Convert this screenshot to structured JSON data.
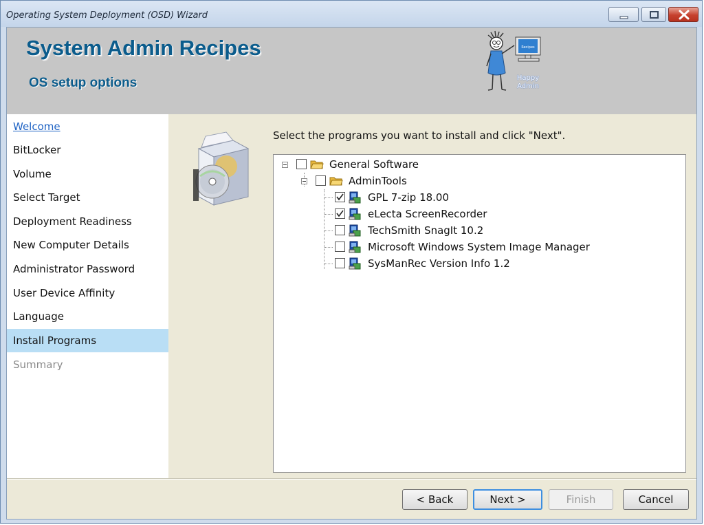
{
  "window": {
    "title": "Operating System Deployment (OSD) Wizard",
    "controls": [
      "minimize-icon",
      "maximize-icon",
      "close-icon"
    ]
  },
  "header": {
    "brand": "System Admin Recipes",
    "subtitle": "OS setup options",
    "logo_caption_line1": "Happy",
    "logo_caption_line2": "Admin",
    "logo_screen_text": "Recipes"
  },
  "nav": {
    "items": [
      {
        "label": "Welcome",
        "state": "link"
      },
      {
        "label": "BitLocker",
        "state": "normal"
      },
      {
        "label": "Volume",
        "state": "normal"
      },
      {
        "label": "Select Target",
        "state": "normal"
      },
      {
        "label": "Deployment Readiness",
        "state": "normal"
      },
      {
        "label": "New Computer Details",
        "state": "normal"
      },
      {
        "label": "Administrator Password",
        "state": "normal"
      },
      {
        "label": "User Device Affinity",
        "state": "normal"
      },
      {
        "label": "Language",
        "state": "normal"
      },
      {
        "label": "Install Programs",
        "state": "active"
      },
      {
        "label": "Summary",
        "state": "disabled"
      }
    ]
  },
  "main": {
    "instruction": "Select the programs you want to install and click \"Next\".",
    "tree": {
      "root": {
        "label": "General Software",
        "checked": false,
        "expanded": true,
        "icon": "folder-icon"
      },
      "group": {
        "label": "AdminTools",
        "checked": false,
        "expanded": true,
        "icon": "folder-icon"
      },
      "programs": [
        {
          "label": "GPL 7-zip 18.00",
          "checked": true,
          "icon": "package-icon"
        },
        {
          "label": "eLecta ScreenRecorder",
          "checked": true,
          "icon": "package-icon"
        },
        {
          "label": "TechSmith SnagIt 10.2",
          "checked": false,
          "icon": "package-icon"
        },
        {
          "label": "Microsoft Windows System Image Manager",
          "checked": false,
          "icon": "package-icon"
        },
        {
          "label": "SysManRec Version Info 1.2",
          "checked": false,
          "icon": "package-icon"
        }
      ]
    }
  },
  "footer": {
    "back": "< Back",
    "next": "Next >",
    "finish": "Finish",
    "cancel": "Cancel"
  },
  "colors": {
    "brand": "#0b5c8c",
    "nav_active": "#b9def5",
    "link": "#1f63c4",
    "header_bg": "#c6c6c6",
    "panel_bg": "#ece9d8"
  }
}
